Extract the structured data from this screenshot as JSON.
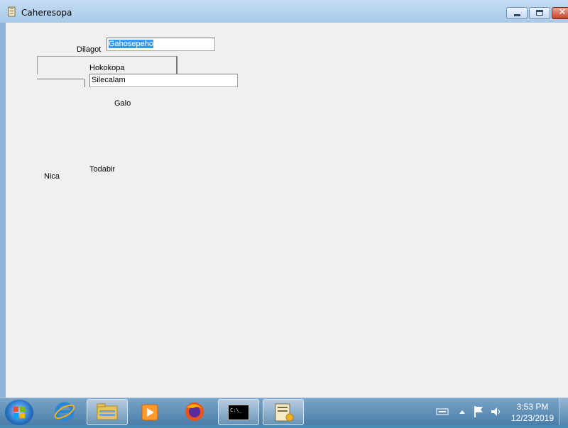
{
  "window": {
    "title": "Caheresopa"
  },
  "form": {
    "label_dilagot": "Dilagot",
    "field_gahosepeho": "Gahosepeho",
    "label_hokokopa": "Hokokopa",
    "field_silecalam": "Silecalam",
    "label_galo": "Galo",
    "label_todabir": "Todabir",
    "label_nica": "Nica"
  },
  "taskbar": {
    "time": "3:53 PM",
    "date": "12/23/2019",
    "cmd_text": "C:\\_"
  }
}
